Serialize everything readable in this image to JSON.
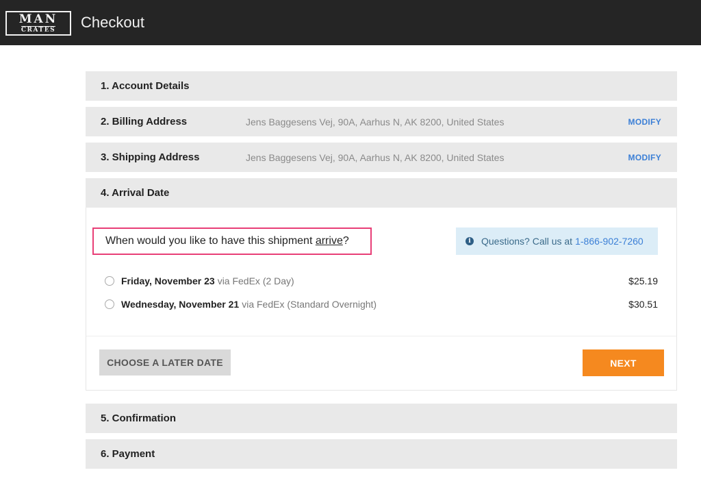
{
  "header": {
    "logo_line1": "MAN",
    "logo_line2": "CRATES",
    "title": "Checkout"
  },
  "steps": [
    {
      "title": "1. Account Details"
    },
    {
      "title": "2. Billing Address",
      "detail": "Jens Baggesens Vej, 90A, Aarhus N, AK 8200, United States",
      "action": "MODIFY"
    },
    {
      "title": "3. Shipping Address",
      "detail": "Jens Baggesens Vej, 90A, Aarhus N, AK 8200, United States",
      "action": "MODIFY"
    },
    {
      "title": "4. Arrival Date"
    },
    {
      "title": "5. Confirmation"
    },
    {
      "title": "6. Payment"
    }
  ],
  "arrival": {
    "question_prefix": "When would you like to have this shipment ",
    "question_keyword": "arrive",
    "question_suffix": "?",
    "help_text": "Questions? Call us at",
    "help_phone": "1-866-902-7260",
    "options": [
      {
        "date": "Friday, November 23",
        "via": "via FedEx (2 Day)",
        "price": "$25.19",
        "selected": false
      },
      {
        "date": "Wednesday, November 21",
        "via": "via FedEx (Standard Overnight)",
        "price": "$30.51",
        "selected": false
      }
    ],
    "later_button": "CHOOSE A LATER DATE",
    "next_button": "NEXT"
  },
  "colors": {
    "header_bg": "#252525",
    "step_bg": "#e9e9e9",
    "link": "#3b7fd6",
    "highlight_border": "#e83e76",
    "next_button": "#f5891f",
    "help_bg": "#dcedf7"
  },
  "icons": {
    "info": "info-icon"
  }
}
